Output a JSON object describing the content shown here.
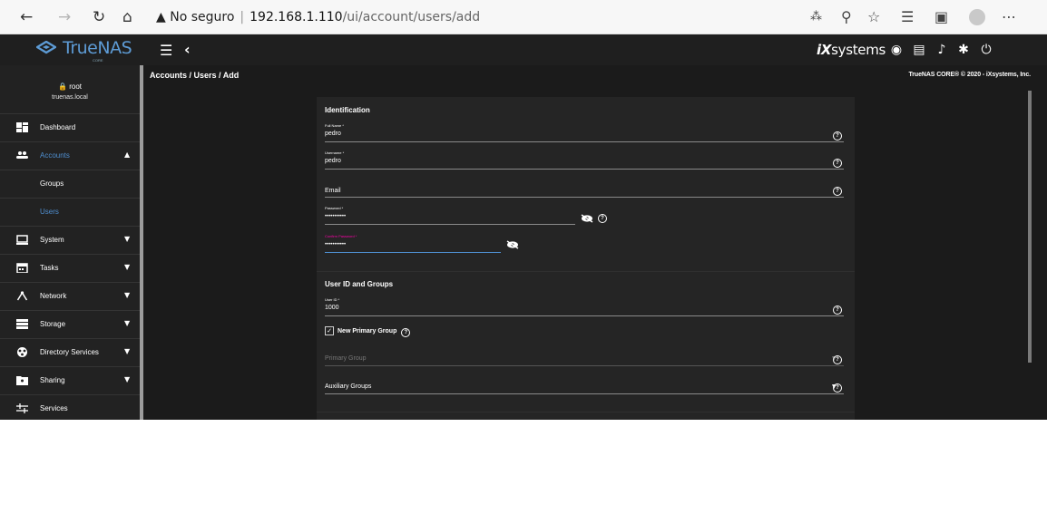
{
  "browser": {
    "security_label": "No seguro",
    "url_host": "192.168.1.110",
    "url_path": "/ui/account/users/add"
  },
  "topbar": {
    "logo_text": "TrueNAS",
    "logo_subtext": "CORE",
    "vendor": "systems"
  },
  "sidebar": {
    "user_name": "root",
    "host": "truenas.local",
    "items": [
      {
        "label": "Dashboard"
      },
      {
        "label": "Accounts"
      },
      {
        "label": "Groups"
      },
      {
        "label": "Users"
      },
      {
        "label": "System"
      },
      {
        "label": "Tasks"
      },
      {
        "label": "Network"
      },
      {
        "label": "Storage"
      },
      {
        "label": "Directory Services"
      },
      {
        "label": "Sharing"
      },
      {
        "label": "Services"
      }
    ]
  },
  "content": {
    "breadcrumb": "Accounts / Users / Add",
    "copyright": "TrueNAS CORE® © 2020 - iXsystems, Inc."
  },
  "form": {
    "identification_title": "Identification",
    "full_name": {
      "label": "Full Name *",
      "value": "pedro"
    },
    "username": {
      "label": "Username *",
      "value": "pedro"
    },
    "email": {
      "label": "Email",
      "value": ""
    },
    "password": {
      "label": "Password *",
      "value": "•••••••••••"
    },
    "confirm_password": {
      "label": "Confirm Password *",
      "value": "•••••••••••"
    },
    "user_groups_title": "User ID and Groups",
    "user_id": {
      "label": "User ID *",
      "value": "1000"
    },
    "new_primary_group": {
      "label": "New Primary Group",
      "checked": true
    },
    "primary_group": {
      "label": "Primary Group",
      "disabled": true
    },
    "auxiliary_groups": {
      "label": "Auxiliary Groups"
    }
  }
}
